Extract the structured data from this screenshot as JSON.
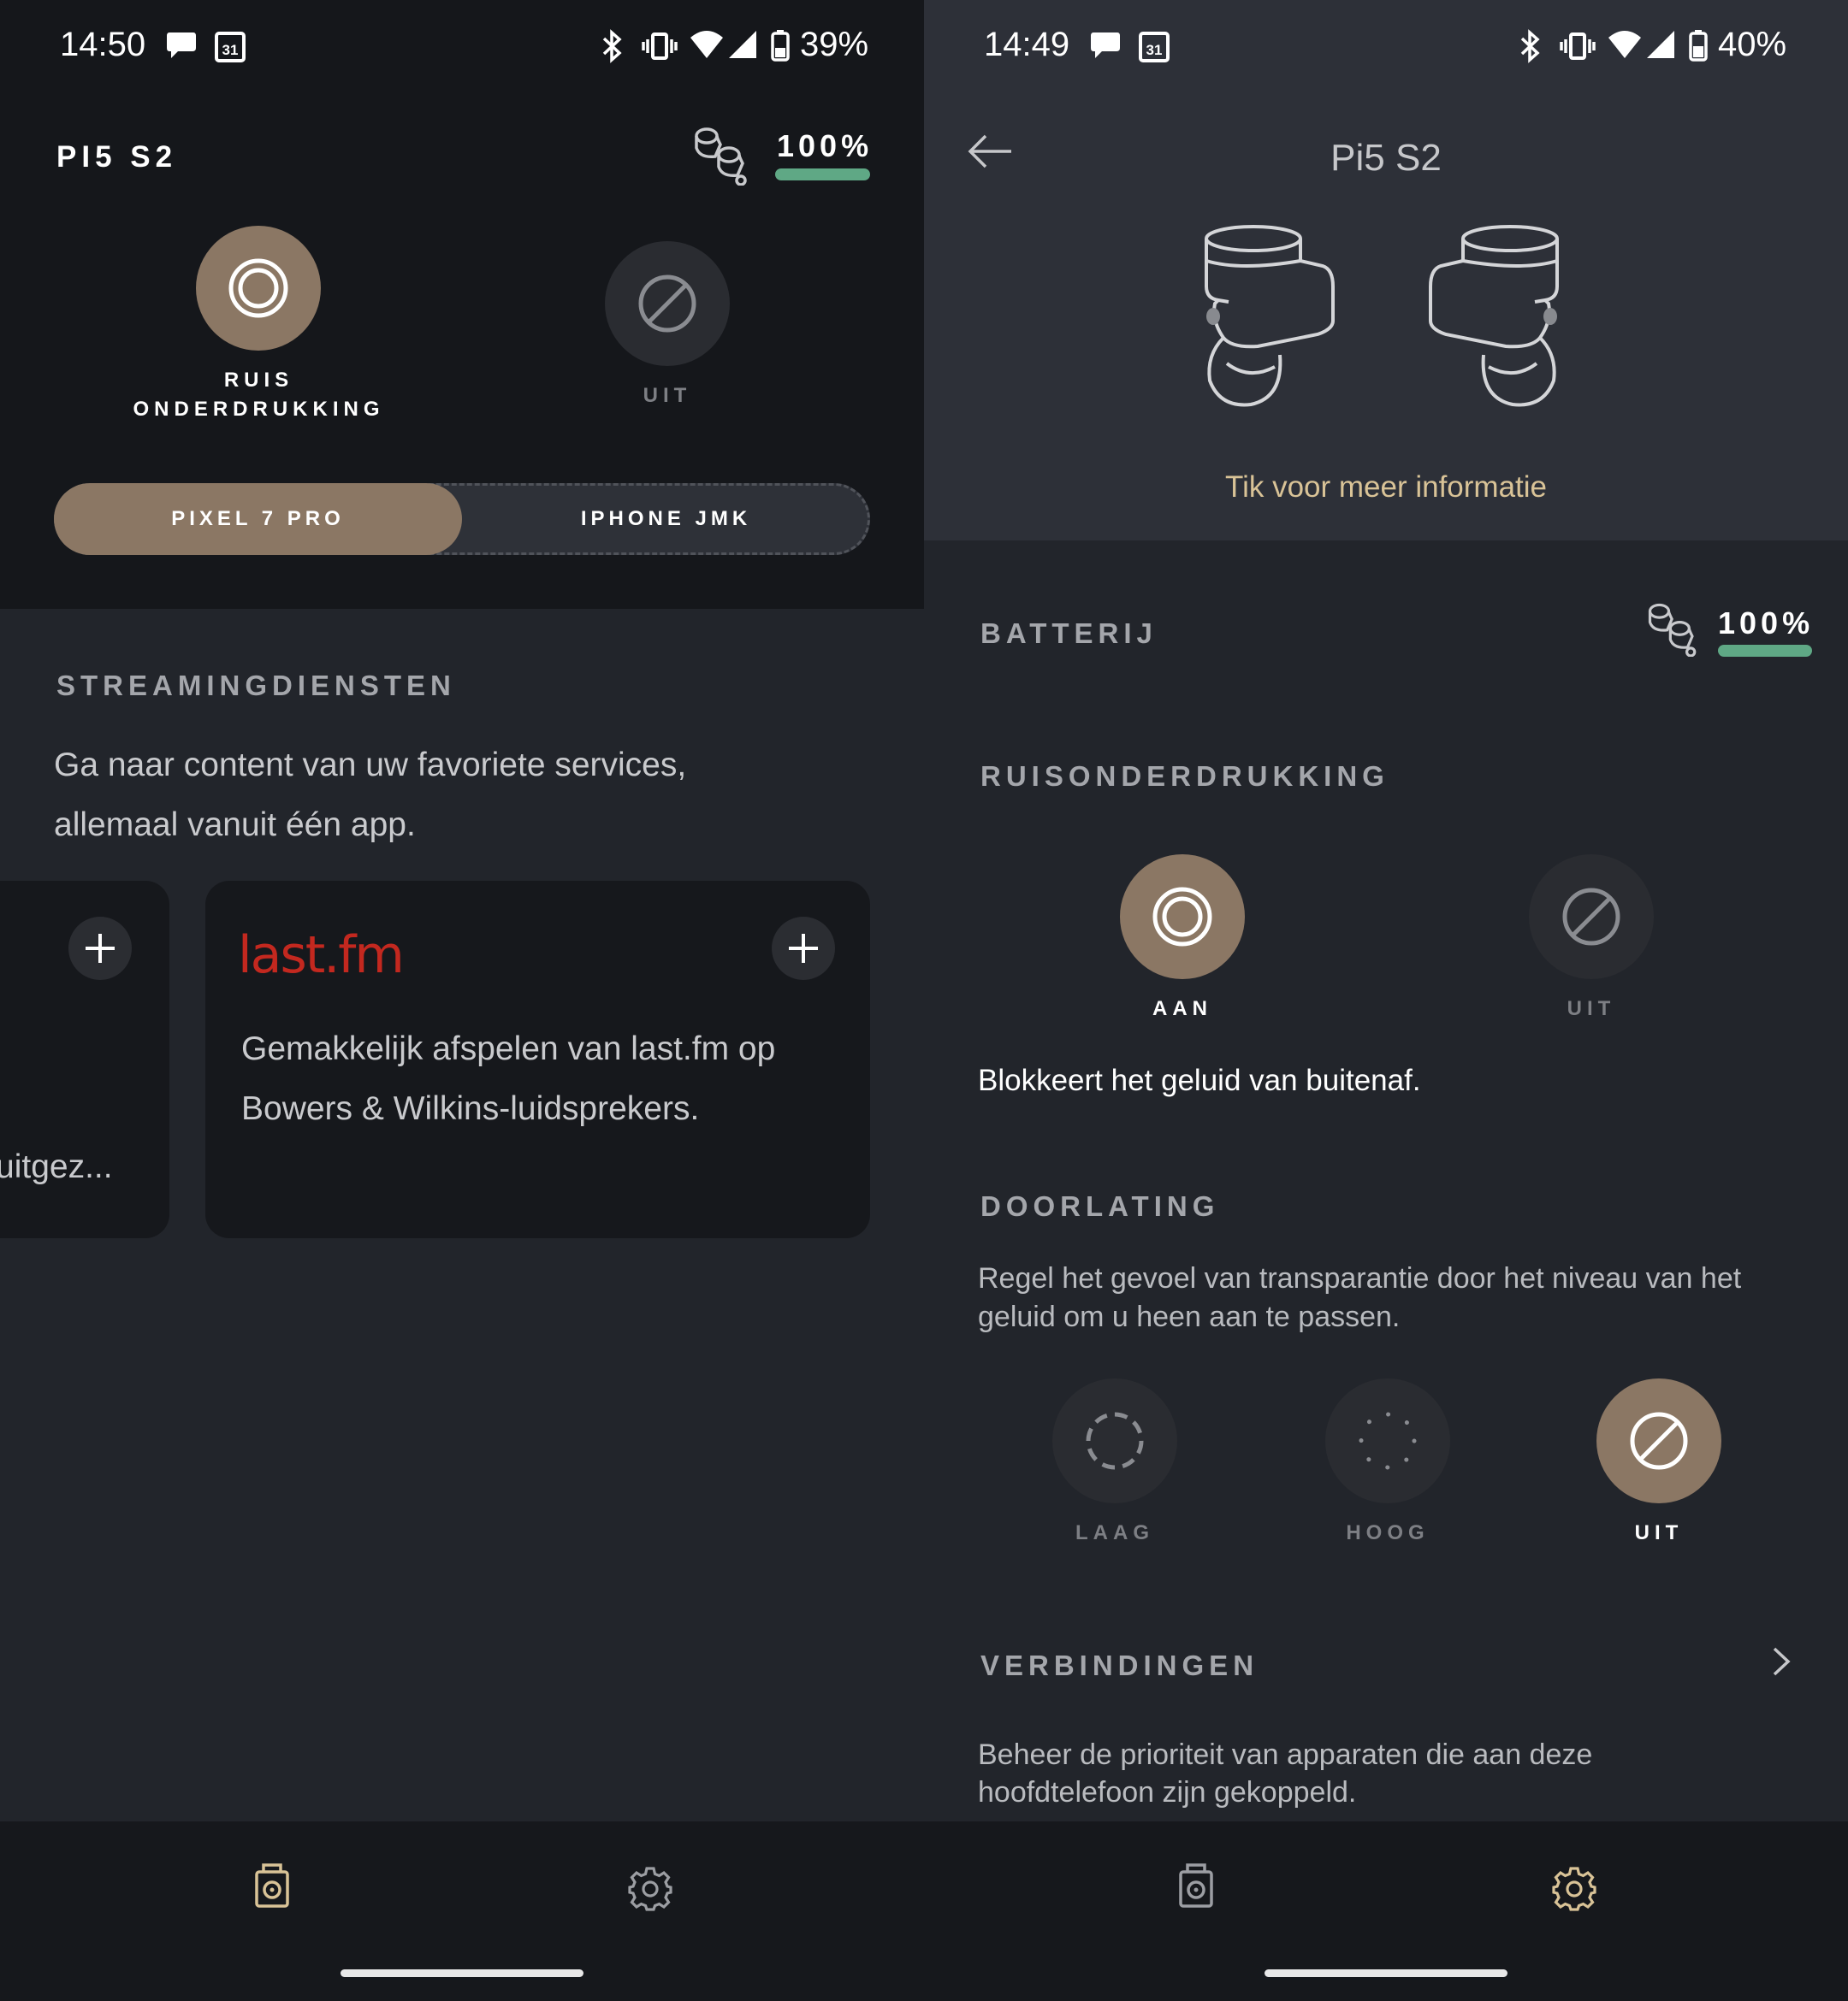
{
  "left": {
    "status": {
      "time": "14:50",
      "battery": "39%"
    },
    "device_title": "PI5 S2",
    "battery_pct": "100%",
    "battery_level": 1.0,
    "modes": [
      {
        "label_1": "RUIS",
        "label_2": "ONDERDRUKKING",
        "active": true,
        "icon": "noise-cancelling-icon"
      },
      {
        "label_1": "UIT",
        "active": false,
        "icon": "off-icon"
      }
    ],
    "sources": {
      "active": "PIXEL 7 PRO",
      "inactive": "IPHONE JMK"
    },
    "streaming": {
      "title": "STREAMINGDIENSTEN",
      "description_1": "Ga naar content van uw favoriete services,",
      "description_2": "allemaal vanuit één app.",
      "partial_card_text": "uitgez...",
      "card": {
        "logo": "last.fm",
        "text_1": "Gemakkelijk afspelen van last.fm op",
        "text_2": "Bowers & Wilkins-luidsprekers."
      }
    }
  },
  "right": {
    "status": {
      "time": "14:49",
      "battery": "40%"
    },
    "title": "Pi5 S2",
    "info_link": "Tik voor meer informatie",
    "battery": {
      "title": "BATTERIJ",
      "pct": "100%",
      "level": 1.0
    },
    "anc": {
      "title": "RUISONDERDRUKKING",
      "on_label": "AAN",
      "off_label": "UIT",
      "description": "Blokkeert het geluid van buitenaf."
    },
    "passthrough": {
      "title": "DOORLATING",
      "description_1": "Regel het gevoel van transparantie door het niveau van het",
      "description_2": "geluid om u heen aan te passen.",
      "options": [
        "LAAG",
        "HOOG",
        "UIT"
      ],
      "selected": "UIT"
    },
    "connections": {
      "title": "VERBINDINGEN",
      "description_1": "Beheer de prioriteit van apparaten die aan deze",
      "description_2": "hoofdtelefoon zijn gekoppeld."
    }
  },
  "colors": {
    "accent": "#8b7764",
    "battery_green": "#5fa885",
    "link_gold": "#d9c397",
    "lastfm_red": "#c3281f"
  }
}
